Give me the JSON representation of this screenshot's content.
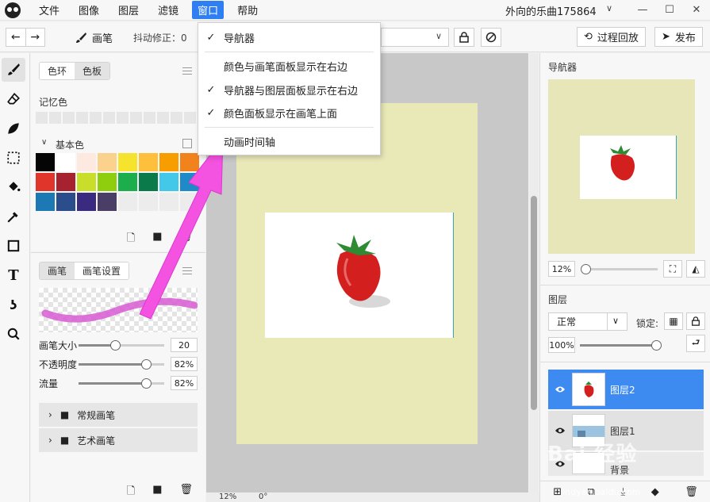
{
  "menubar": {
    "items": [
      "文件",
      "图像",
      "图层",
      "滤镜",
      "窗口",
      "帮助"
    ],
    "active": "窗口",
    "document_title": "外向的乐曲175864"
  },
  "toolbar": {
    "brush_label": "画笔",
    "stabilizer_label": "抖动修正：0",
    "replay_label": "过程回放",
    "publish_label": "发布"
  },
  "window_menu": {
    "items": [
      {
        "label": "导航器",
        "checked": true
      },
      {
        "label": "颜色与画笔面板显示在右边",
        "checked": false
      },
      {
        "label": "导航器与图层面板显示在右边",
        "checked": true
      },
      {
        "label": "颜色面板显示在画笔上面",
        "checked": true
      },
      {
        "label": "动画时间轴",
        "checked": false
      }
    ]
  },
  "color_panel": {
    "tabs": [
      "色环",
      "色板"
    ],
    "active_tab": "色板",
    "memory_label": "记忆色",
    "basic_label": "基本色",
    "swatches": [
      "#050505",
      "#ffffff",
      "#fde9e0",
      "#fbd18e",
      "#f6e32d",
      "#fdbf3c",
      "#f79d00",
      "#f2831c",
      "#e0352a",
      "#a6222f",
      "#c9dd2b",
      "#8fcd0f",
      "#1cae4c",
      "#0a7a4a",
      "#43c8ea",
      "#1e8ac7",
      "#1d79b4",
      "#2b4d8c",
      "#3a2a80",
      "#4a3e66",
      "#ececec",
      "#ececec",
      "#ececec",
      "#ececec"
    ]
  },
  "brush_panel": {
    "tabs": [
      "画笔",
      "画笔设置"
    ],
    "active_tab": "画笔",
    "sliders": [
      {
        "label": "画笔大小",
        "value": "20",
        "fraction": 0.43
      },
      {
        "label": "不透明度",
        "value": "82%",
        "fraction": 0.79
      },
      {
        "label": "流量",
        "value": "82%",
        "fraction": 0.79
      }
    ],
    "folders": [
      "常规画笔",
      "艺术画笔"
    ]
  },
  "canvas": {
    "zoom": "12%",
    "rotation": "0°"
  },
  "navigator": {
    "title": "导航器",
    "zoom": "12%",
    "zoom_fraction": 0.05
  },
  "layers": {
    "title": "图层",
    "blend_mode": "正常",
    "lock_label": "锁定:",
    "opacity": "100%",
    "opacity_fraction": 1.0,
    "rows": [
      {
        "name": "图层2",
        "selected": true
      },
      {
        "name": "图层1",
        "selected": false
      },
      {
        "name": "背景",
        "selected": false
      }
    ]
  },
  "watermark": {
    "text": "Bai 经验",
    "sub": "jingyan.baidu.com"
  },
  "colors": {
    "accent": "#2f7ff2",
    "arrow": "#f452e0",
    "page": "#e9e9b8"
  }
}
